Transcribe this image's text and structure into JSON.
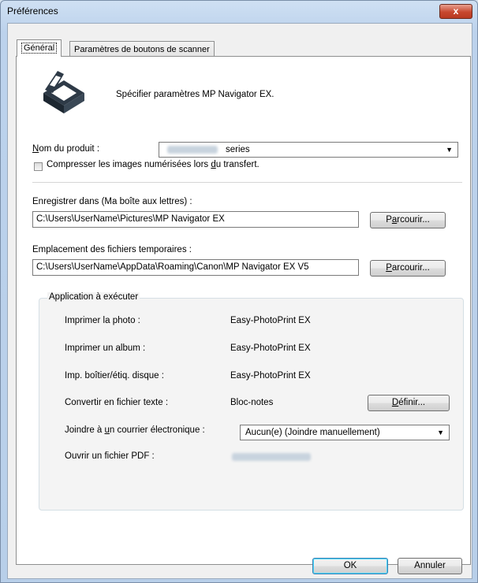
{
  "window": {
    "title": "Préférences",
    "close_glyph": "x"
  },
  "tabs": [
    {
      "label": "Général",
      "active": true
    },
    {
      "label": "Paramètres de boutons de scanner",
      "active": false
    }
  ],
  "header": {
    "icon": "scanner-icon",
    "text": "Spécifier paramètres MP Navigator EX."
  },
  "product": {
    "label_prefix": "N",
    "label_rest": "om du produit :",
    "value_suffix": "series"
  },
  "compress": {
    "checked": false,
    "label_a": "Compresser les images numérisées lors ",
    "label_u": "d",
    "label_b": "u transfert."
  },
  "save_to": {
    "label": "Enregistrer dans (Ma boîte aux lettres) :",
    "value": "C:\\Users\\UserName\\Pictures\\MP Navigator EX",
    "browse_a": "P",
    "browse_u": "a",
    "browse_b": "rcourir..."
  },
  "temp_files": {
    "label": "Emplacement des fichiers temporaires :",
    "value": "C:\\Users\\UserName\\AppData\\Roaming\\Canon\\MP Navigator EX V5",
    "browse_a": "",
    "browse_u": "P",
    "browse_b": "arcourir..."
  },
  "apps": {
    "group_title": "Application à exécuter",
    "rows": [
      {
        "label": "Imprimer la photo :",
        "value": "Easy-PhotoPrint EX"
      },
      {
        "label": "Imprimer un album :",
        "value": "Easy-PhotoPrint EX"
      },
      {
        "label": "Imp. boîtier/étiq. disque :",
        "value": "Easy-PhotoPrint EX"
      },
      {
        "label": "Convertir en fichier texte :",
        "value": "Bloc-notes"
      }
    ],
    "define_a": "",
    "define_u": "D",
    "define_b": "éfinir...",
    "email_label_a": "Joindre à ",
    "email_label_u": "u",
    "email_label_b": "n courrier électronique :",
    "email_value": "Aucun(e) (Joindre manuellement)",
    "pdf_label": "Ouvrir un fichier PDF :"
  },
  "footer": {
    "ok": "OK",
    "cancel": "Annuler"
  }
}
